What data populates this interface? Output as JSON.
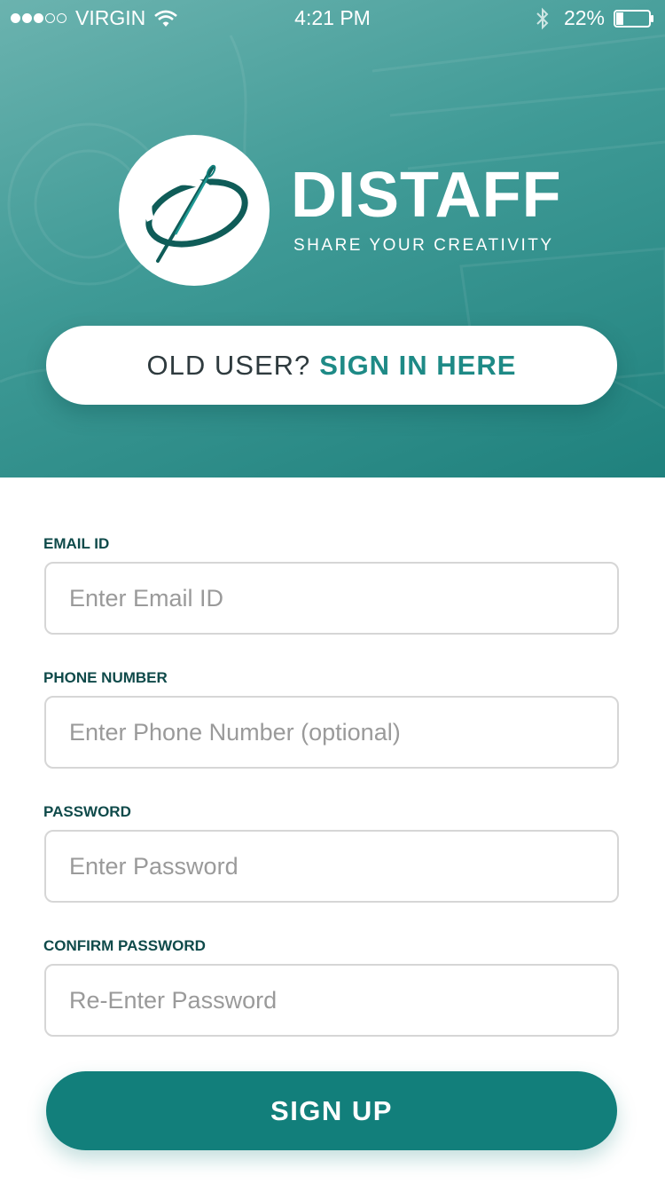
{
  "status_bar": {
    "carrier": "VIRGIN",
    "time": "4:21 PM",
    "battery_percent": "22%",
    "battery_level": 0.22,
    "signal_bars_filled": 3,
    "signal_bars_total": 5
  },
  "brand": {
    "name": "DISTAFF",
    "tagline": "SHARE YOUR CREATIVITY",
    "logo_icon": "needle-thread-icon"
  },
  "signin": {
    "prefix": "OLD USER?",
    "link": "SIGN IN HERE"
  },
  "form": {
    "email": {
      "label": "EMAIL ID",
      "placeholder": "Enter Email ID"
    },
    "phone": {
      "label": "PHONE NUMBER",
      "placeholder": "Enter Phone Number (optional)"
    },
    "password": {
      "label": "PASSWORD",
      "placeholder": "Enter Password"
    },
    "confirm": {
      "label": "CONFIRM PASSWORD",
      "placeholder": "Re-Enter Password"
    },
    "submit": "SIGN UP"
  },
  "colors": {
    "accent": "#127f7b",
    "hero_top": "#6bb3af",
    "hero_bottom": "#1f817d",
    "label": "#0f4a4a"
  }
}
